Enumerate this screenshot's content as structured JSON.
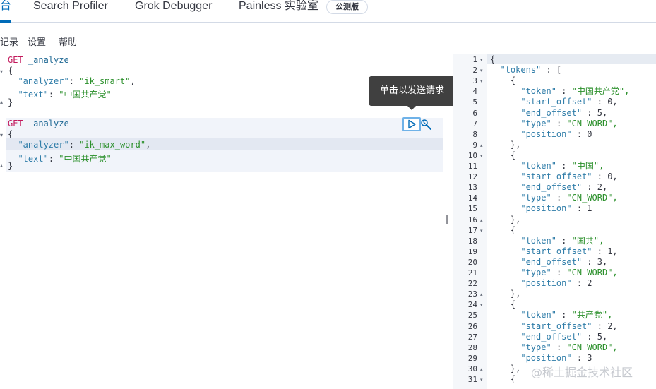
{
  "tabs": [
    {
      "label": "台"
    },
    {
      "label": "Search Profiler"
    },
    {
      "label": "Grok Debugger"
    },
    {
      "label": "Painless 实验室"
    }
  ],
  "beta_badge": "公测版",
  "menu": [
    {
      "label": "记录"
    },
    {
      "label": "设置"
    },
    {
      "label": "帮助"
    }
  ],
  "request1": {
    "method": "GET",
    "path": " _analyze",
    "open": "{",
    "close": "}",
    "k1": "\"analyzer\"",
    "v1": "\"ik_smart\"",
    "k2": "\"text\"",
    "v2": "\"中国共产党\""
  },
  "request2": {
    "method": "GET",
    "path": " _analyze",
    "open": "{",
    "close": "}",
    "k1": "\"analyzer\"",
    "v1": "\"ik_max_word\"",
    "k2": "\"text\"",
    "v2": "\"中国共产党\""
  },
  "tooltip": "单击以发送请求",
  "run_icon": "play-icon",
  "settings_icon": "wrench-icon",
  "divider_glyph": "‖",
  "response": {
    "lines": [
      "{",
      "  \"tokens\" : [",
      "    {",
      "      \"token\" : \"中国共产党\",",
      "      \"start_offset\" : 0,",
      "      \"end_offset\" : 5,",
      "      \"type\" : \"CN_WORD\",",
      "      \"position\" : 0",
      "    },",
      "    {",
      "      \"token\" : \"中国\",",
      "      \"start_offset\" : 0,",
      "      \"end_offset\" : 2,",
      "      \"type\" : \"CN_WORD\",",
      "      \"position\" : 1",
      "    },",
      "    {",
      "      \"token\" : \"国共\",",
      "      \"start_offset\" : 1,",
      "      \"end_offset\" : 3,",
      "      \"type\" : \"CN_WORD\",",
      "      \"position\" : 2",
      "    },",
      "    {",
      "      \"token\" : \"共产党\",",
      "      \"start_offset\" : 2,",
      "      \"end_offset\" : 5,",
      "      \"type\" : \"CN_WORD\",",
      "      \"position\" : 3",
      "    },",
      "    {"
    ],
    "line_numbers": [
      "1",
      "2",
      "3",
      "4",
      "5",
      "6",
      "7",
      "8",
      "9",
      "10",
      "11",
      "12",
      "13",
      "14",
      "15",
      "16",
      "17",
      "18",
      "19",
      "20",
      "21",
      "22",
      "23",
      "24",
      "25",
      "26",
      "27",
      "28",
      "29",
      "30",
      "31"
    ]
  },
  "watermark": "@稀土掘金技术社区"
}
